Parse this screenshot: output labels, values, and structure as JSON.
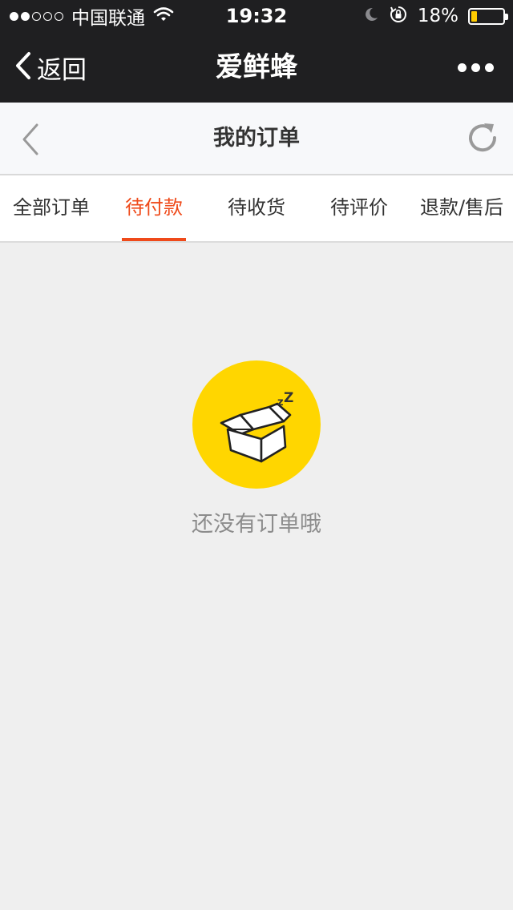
{
  "status_bar": {
    "carrier": "中国联通",
    "time": "19:32",
    "battery_percent_label": "18%",
    "battery_level": 0.18,
    "signal_strength": 2,
    "signal_max": 5,
    "icons": [
      "wifi-icon",
      "moon-icon",
      "rotation-lock-icon",
      "battery-icon"
    ]
  },
  "nav": {
    "back_label": "返回",
    "title": "爱鲜蜂",
    "more_icon": "more-dots-icon"
  },
  "sub_header": {
    "title": "我的订单",
    "back_icon": "chevron-left-icon",
    "refresh_icon": "refresh-icon"
  },
  "tabs": [
    {
      "label": "全部订单",
      "active": false
    },
    {
      "label": "待付款",
      "active": true
    },
    {
      "label": "待收货",
      "active": false
    },
    {
      "label": "待评价",
      "active": false
    },
    {
      "label": "退款/售后",
      "active": false
    }
  ],
  "empty_state": {
    "icon": "empty-box-icon",
    "message": "还没有订单哦"
  },
  "colors": {
    "dark_bar": "#1f1f21",
    "accent": "#ef4a1a",
    "empty_icon_bg": "#ffd600",
    "battery_fill": "#ffcc00",
    "page_bg": "#efefef"
  }
}
